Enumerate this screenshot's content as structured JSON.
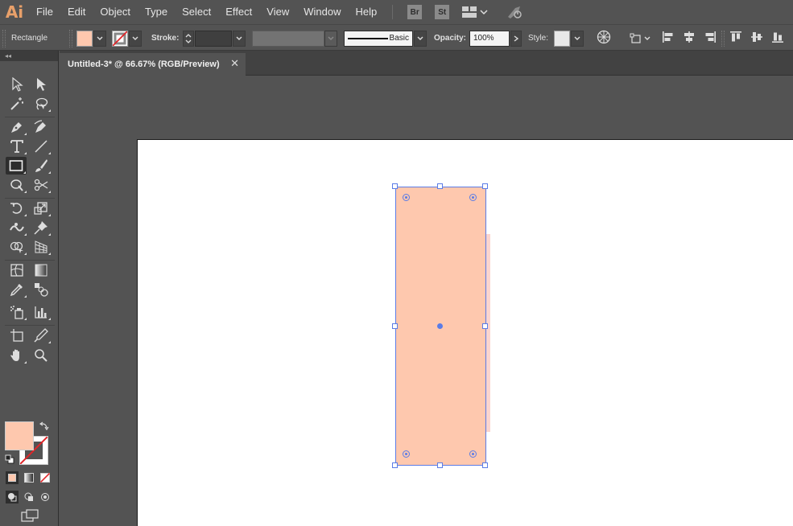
{
  "app": {
    "logo": "Ai",
    "menu": [
      "File",
      "Edit",
      "Object",
      "Type",
      "Select",
      "Effect",
      "View",
      "Window",
      "Help"
    ],
    "bridge_badge": "Br",
    "stock_badge": "St"
  },
  "control_bar": {
    "tool_name": "Rectangle",
    "fill_color": "#fec8ae",
    "stroke_label": "Stroke:",
    "brush_label": "Basic",
    "opacity_label": "Opacity:",
    "opacity_value": "100%",
    "style_label": "Style:"
  },
  "document": {
    "tab_title": "Untitled-3* @ 66.67% (RGB/Preview)",
    "close_glyph": "✕"
  },
  "toolbox": {
    "collapse_glyph": "◂◂",
    "fill_color": "#fec8ae",
    "selected_tool": "rectangle-tool"
  },
  "colors": {
    "shape_fill": "#fec8ae",
    "selection": "#5b7ce6",
    "artboard": "#ffffff",
    "pasteboard": "#535353"
  }
}
